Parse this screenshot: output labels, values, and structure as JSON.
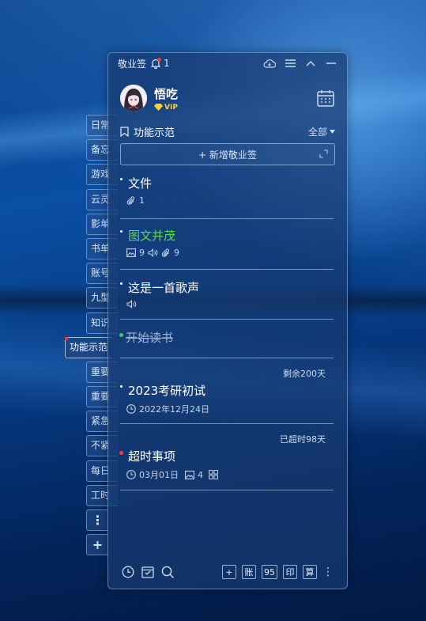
{
  "titlebar": {
    "app_name": "敬业签",
    "notification_count": "1"
  },
  "profile": {
    "name": "悟吃",
    "vip_label": "VIP"
  },
  "side_tabs": [
    {
      "label": "日常"
    },
    {
      "label": "备忘"
    },
    {
      "label": "游戏"
    },
    {
      "label": "云灵"
    },
    {
      "label": "影单"
    },
    {
      "label": "书单"
    },
    {
      "label": "账号"
    },
    {
      "label": "九型"
    },
    {
      "label": "知识"
    },
    {
      "label": "功能示范"
    },
    {
      "label": "重要"
    },
    {
      "label": "重要"
    },
    {
      "label": "紧急"
    },
    {
      "label": "不紧"
    },
    {
      "label": "每日"
    },
    {
      "label": "工时"
    }
  ],
  "side_more_icon": "⋮",
  "side_add_icon": "+",
  "section": {
    "title": "功能示范",
    "filter_label": "全部"
  },
  "add_button": {
    "label": "+ 新增敬业签"
  },
  "notes": [
    {
      "title": "文件",
      "attachments": "1"
    },
    {
      "title": "图文并茂",
      "images": "9",
      "attachments": "9",
      "color": "#5fd64d"
    },
    {
      "title": "这是一首歌声"
    },
    {
      "title": "开始读书",
      "status": "completed",
      "dot_color": "#3fcf53"
    },
    {
      "title": "2023考研初试",
      "tag": "剩余200天",
      "date": "2022年12月24日"
    },
    {
      "title": "超时事项",
      "tag": "已超时98天",
      "date": "03月01日",
      "images": "4",
      "dot_color": "#ff3b30"
    }
  ],
  "bottom": {
    "buttons": [
      "+",
      "账",
      "95",
      "印",
      "算"
    ],
    "more": "⋮"
  }
}
